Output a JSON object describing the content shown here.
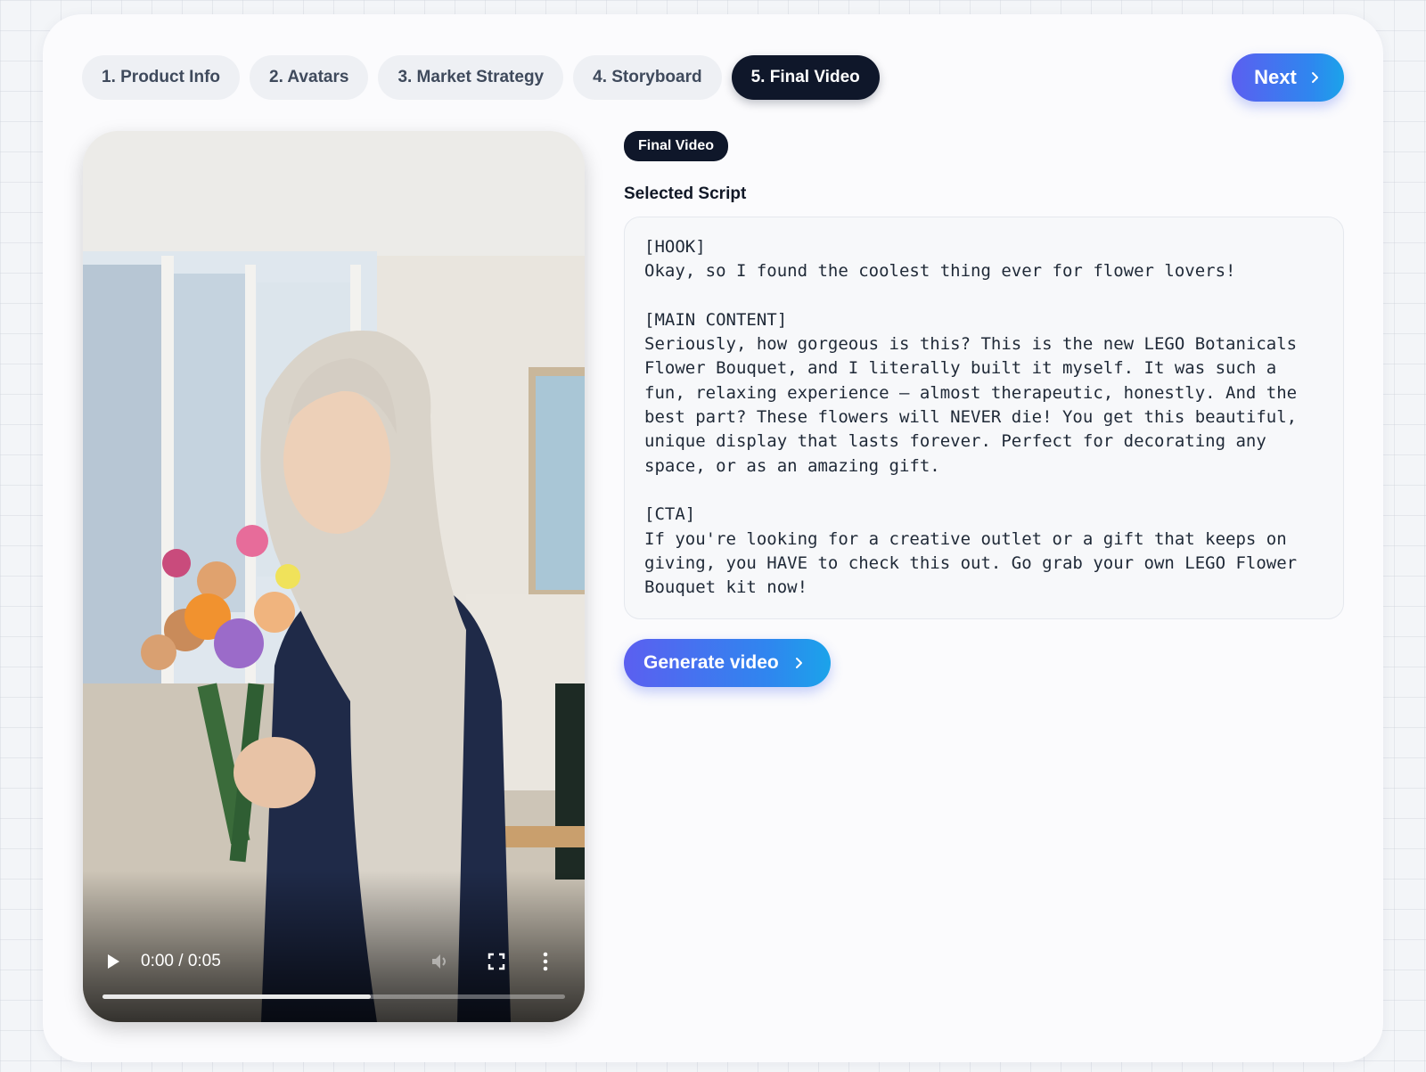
{
  "tabs": [
    {
      "label": "1. Product Info",
      "active": false
    },
    {
      "label": "2. Avatars",
      "active": false
    },
    {
      "label": "3. Market Strategy",
      "active": false
    },
    {
      "label": "4. Storyboard",
      "active": false
    },
    {
      "label": "5. Final Video",
      "active": true
    }
  ],
  "next_button": {
    "label": "Next",
    "icon": "chevron-right-icon"
  },
  "video": {
    "time": "0:00 / 0:05",
    "progress_fraction": 0.58,
    "icons": [
      "play-icon",
      "volume-icon",
      "fullscreen-icon",
      "more-vert-icon"
    ]
  },
  "panel": {
    "badge": "Final Video",
    "section_title": "Selected Script",
    "script": "[HOOK]\nOkay, so I found the coolest thing ever for flower lovers!\n\n[MAIN CONTENT]\nSeriously, how gorgeous is this? This is the new LEGO Botanicals Flower Bouquet, and I literally built it myself. It was such a fun, relaxing experience – almost therapeutic, honestly. And the best part? These flowers will NEVER die! You get this beautiful, unique display that lasts forever. Perfect for decorating any space, or as an amazing gift.\n\n[CTA]\nIf you're looking for a creative outlet or a gift that keeps on giving, you HAVE to check this out. Go grab your own LEGO Flower Bouquet kit now!",
    "generate_button": "Generate video"
  },
  "colors": {
    "accent_start": "#5b5ff0",
    "accent_end": "#1ba3ea",
    "active_tab": "#0f172a"
  }
}
